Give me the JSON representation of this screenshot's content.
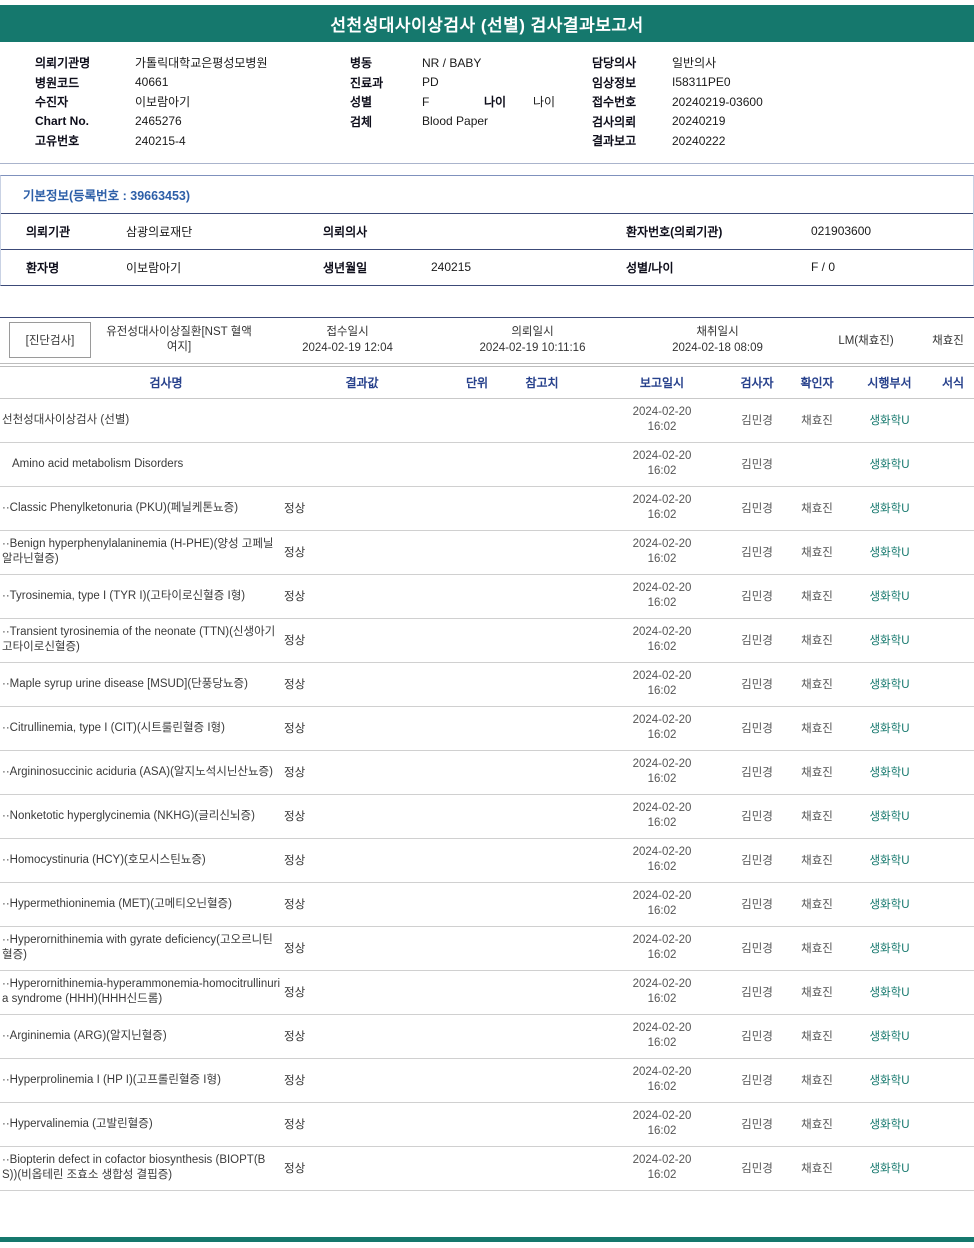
{
  "report": {
    "title": "선천성대사이상검사 (선별) 검사결과보고서"
  },
  "colors": {
    "accent_teal": "#15786d",
    "section_title_blue": "#2d5fa8",
    "table_header_blue": "#27418c"
  },
  "hospital_info": {
    "columns": [
      {
        "rows": [
          {
            "label": "의뢰기관명",
            "value": "가톨릭대학교은평성모병원"
          },
          {
            "label": "병원코드",
            "value": "40661"
          },
          {
            "label": "수진자",
            "value": "이보람아기"
          },
          {
            "label": "Chart No.",
            "value": "2465276"
          },
          {
            "label": "고유번호",
            "value": "240215-4"
          }
        ]
      },
      {
        "rows": [
          {
            "label": "병동",
            "value": "NR / BABY"
          },
          {
            "label": "진료과",
            "value": "PD"
          },
          {
            "label": "성별",
            "value": "F",
            "label2": "나이",
            "value2": "나이"
          },
          {
            "label": "검체",
            "value": "Blood Paper"
          }
        ]
      },
      {
        "rows": [
          {
            "label": "담당의사",
            "value": "일반의사"
          },
          {
            "label": "임상정보",
            "value": "I58311PE0"
          },
          {
            "label": "접수번호",
            "value": "20240219-03600"
          },
          {
            "label": "검사의뢰",
            "value": "20240219"
          },
          {
            "label": "결과보고",
            "value": "20240222"
          }
        ]
      }
    ]
  },
  "basic_info": {
    "title": "기본정보(등록번호 : 39663453)",
    "rows": [
      [
        {
          "label": "의뢰기관",
          "value": "삼광의료재단"
        },
        {
          "label": "의뢰의사",
          "value": ""
        },
        {
          "label": "환자번호(의뢰기관)",
          "value": "021903600"
        }
      ],
      [
        {
          "label": "환자명",
          "value": "이보람아기"
        },
        {
          "label": "생년월일",
          "value": "240215"
        },
        {
          "label": "성별/나이",
          "value": "F / 0"
        }
      ]
    ]
  },
  "exam_section": {
    "tag": "[진단검사]",
    "test_group": "유전성대사이상질환[NST 혈액여지]",
    "columns": [
      {
        "label": "접수일시",
        "value": "2024-02-19 12:04"
      },
      {
        "label": "의뢰일시",
        "value": "2024-02-19 10:11:16"
      },
      {
        "label": "채취일시",
        "value": "2024-02-18 08:09"
      }
    ],
    "collector": "LM(채효진)",
    "collector2": "채효진"
  },
  "results_table": {
    "headers": [
      "검사명",
      "결과값",
      "단위",
      "참고치",
      "보고일시",
      "검사자",
      "확인자",
      "시행부서",
      "서식"
    ],
    "rows": [
      {
        "name": "선천성대사이상검사 (선별)",
        "result": "",
        "reported_date": "2024-02-20",
        "reported_time": "16:02",
        "examiner": "김민경",
        "confirmer": "채효진",
        "dept": "생화학U"
      },
      {
        "name": "Amino acid metabolism Disorders",
        "indent": true,
        "result": "",
        "reported_date": "2024-02-20",
        "reported_time": "16:02",
        "examiner": "김민경",
        "confirmer": "",
        "dept": "생화학U"
      },
      {
        "name": "··Classic Phenylketonuria (PKU)(페닐케톤뇨증)",
        "result": "정상",
        "reported_date": "2024-02-20",
        "reported_time": "16:02",
        "examiner": "김민경",
        "confirmer": "채효진",
        "dept": "생화학U"
      },
      {
        "name": "··Benign hyperphenylalaninemia (H-PHE)(양성 고페닐알라닌혈증)",
        "result": "정상",
        "reported_date": "2024-02-20",
        "reported_time": "16:02",
        "examiner": "김민경",
        "confirmer": "채효진",
        "dept": "생화학U"
      },
      {
        "name": "··Tyrosinemia, type I (TYR I)(고타이로신혈증 I형)",
        "result": "정상",
        "reported_date": "2024-02-20",
        "reported_time": "16:02",
        "examiner": "김민경",
        "confirmer": "채효진",
        "dept": "생화학U"
      },
      {
        "name": "··Transient tyrosinemia of the neonate (TTN)(신생아기 고타이로신혈증)",
        "result": "정상",
        "reported_date": "2024-02-20",
        "reported_time": "16:02",
        "examiner": "김민경",
        "confirmer": "채효진",
        "dept": "생화학U"
      },
      {
        "name": "··Maple syrup urine disease [MSUD](단풍당뇨증)",
        "result": "정상",
        "reported_date": "2024-02-20",
        "reported_time": "16:02",
        "examiner": "김민경",
        "confirmer": "채효진",
        "dept": "생화학U"
      },
      {
        "name": "··Citrullinemia, type I (CIT)(시트룰린혈증 I형)",
        "result": "정상",
        "reported_date": "2024-02-20",
        "reported_time": "16:02",
        "examiner": "김민경",
        "confirmer": "채효진",
        "dept": "생화학U"
      },
      {
        "name": "··Argininosuccinic aciduria (ASA)(알지노석시닌산뇨증)",
        "result": "정상",
        "reported_date": "2024-02-20",
        "reported_time": "16:02",
        "examiner": "김민경",
        "confirmer": "채효진",
        "dept": "생화학U"
      },
      {
        "name": "··Nonketotic hyperglycinemia (NKHG)(글리신뇌증)",
        "result": "정상",
        "reported_date": "2024-02-20",
        "reported_time": "16:02",
        "examiner": "김민경",
        "confirmer": "채효진",
        "dept": "생화학U"
      },
      {
        "name": "··Homocystinuria (HCY)(호모시스틴뇨증)",
        "result": "정상",
        "reported_date": "2024-02-20",
        "reported_time": "16:02",
        "examiner": "김민경",
        "confirmer": "채효진",
        "dept": "생화학U"
      },
      {
        "name": "··Hypermethioninemia (MET)(고메티오닌혈증)",
        "result": "정상",
        "reported_date": "2024-02-20",
        "reported_time": "16:02",
        "examiner": "김민경",
        "confirmer": "채효진",
        "dept": "생화학U"
      },
      {
        "name": "··Hyperornithinemia with gyrate deficiency(고오르니틴혈증)",
        "result": "정상",
        "reported_date": "2024-02-20",
        "reported_time": "16:02",
        "examiner": "김민경",
        "confirmer": "채효진",
        "dept": "생화학U"
      },
      {
        "name": "··Hyperornithinemia-hyperammonemia-homocitrullinuria syndrome (HHH)(HHH신드롬)",
        "result": "정상",
        "reported_date": "2024-02-20",
        "reported_time": "16:02",
        "examiner": "김민경",
        "confirmer": "채효진",
        "dept": "생화학U"
      },
      {
        "name": "··Argininemia (ARG)(알지닌혈증)",
        "result": "정상",
        "reported_date": "2024-02-20",
        "reported_time": "16:02",
        "examiner": "김민경",
        "confirmer": "채효진",
        "dept": "생화학U"
      },
      {
        "name": "··Hyperprolinemia I (HP I)(고프롤린혈증 I형)",
        "result": "정상",
        "reported_date": "2024-02-20",
        "reported_time": "16:02",
        "examiner": "김민경",
        "confirmer": "채효진",
        "dept": "생화학U"
      },
      {
        "name": "··Hypervalinemia (고발린혈증)",
        "result": "정상",
        "reported_date": "2024-02-20",
        "reported_time": "16:02",
        "examiner": "김민경",
        "confirmer": "채효진",
        "dept": "생화학U"
      },
      {
        "name": "··Biopterin defect in cofactor biosynthesis (BIOPT(BS))(비옵테린 조효소 생합성 결핍증)",
        "result": "정상",
        "reported_date": "2024-02-20",
        "reported_time": "16:02",
        "examiner": "김민경",
        "confirmer": "채효진",
        "dept": "생화학U"
      }
    ]
  }
}
